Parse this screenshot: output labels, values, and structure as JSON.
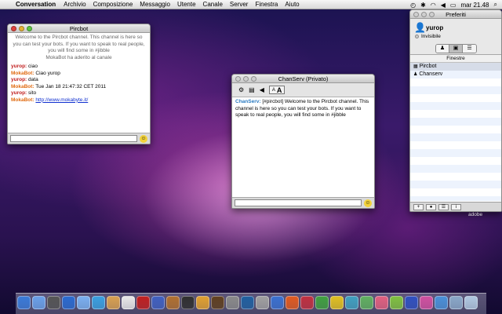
{
  "menubar": {
    "app_name": "Conversation",
    "items": [
      "Archivio",
      "Composizione",
      "Messaggio",
      "Utente",
      "Canale",
      "Server",
      "Finestra",
      "Aiuto"
    ],
    "clock": "mar 21.48"
  },
  "pircbot_window": {
    "title": "Pircbot",
    "welcome": "Welcome to the Pircbot channel. This channel is here so you can test your bots. If you want to speak to real people, you will find some in #jibble",
    "join_notice": "MokaBot ha aderito al canale",
    "messages": [
      {
        "nick": "yurop:",
        "text": " ciao",
        "kind": "self"
      },
      {
        "nick": "MokaBot:",
        "text": " Ciao yurop",
        "kind": "other"
      },
      {
        "nick": "yurop:",
        "text": " data",
        "kind": "self"
      },
      {
        "nick": "MokaBot:",
        "text": " Tue Jan 18 21:47:32 CET 2011",
        "kind": "other"
      },
      {
        "nick": "yurop:",
        "text": " sito",
        "kind": "self"
      },
      {
        "nick": "MokaBot:",
        "text": " ",
        "kind": "other",
        "link": "http://www.mokabyte.it/"
      }
    ]
  },
  "chanserv_window": {
    "title": "ChanServ (Privato)",
    "font_small": "A",
    "font_large": "A",
    "message_nick": "ChanServ:",
    "message_text": " [#pircbot] Welcome to the Pircbot channel. This channel is here so you can test your bots. If you want to speak to real people, you will find some in #jibble"
  },
  "preferiti_window": {
    "title": "Preferiti",
    "user": "yurop",
    "status": "Invisibile",
    "list_header": "Finestre",
    "items": [
      "Pircbot",
      "Chanserv"
    ]
  },
  "dock": {
    "colors": [
      "#3a7ad8",
      "#6aa0e8",
      "#555555",
      "#2a6ad0",
      "#7ab0f0",
      "#3aa0e0",
      "#d8a050",
      "#e8e8e8",
      "#c02020",
      "#4060c0",
      "#b07030",
      "#303030",
      "#e0a030",
      "#604020",
      "#8a8a8a",
      "#2060a0",
      "#a0a0a0",
      "#3a70d0",
      "#e05a20",
      "#c03040",
      "#40a040",
      "#e0c020",
      "#40a0c0",
      "#60b060",
      "#e06080",
      "#80c040",
      "#3050c0",
      "#d050a0",
      "#4a90d8",
      "#8aa8c8",
      "#b0c8e0"
    ]
  },
  "wallpaper_label": "adobe"
}
